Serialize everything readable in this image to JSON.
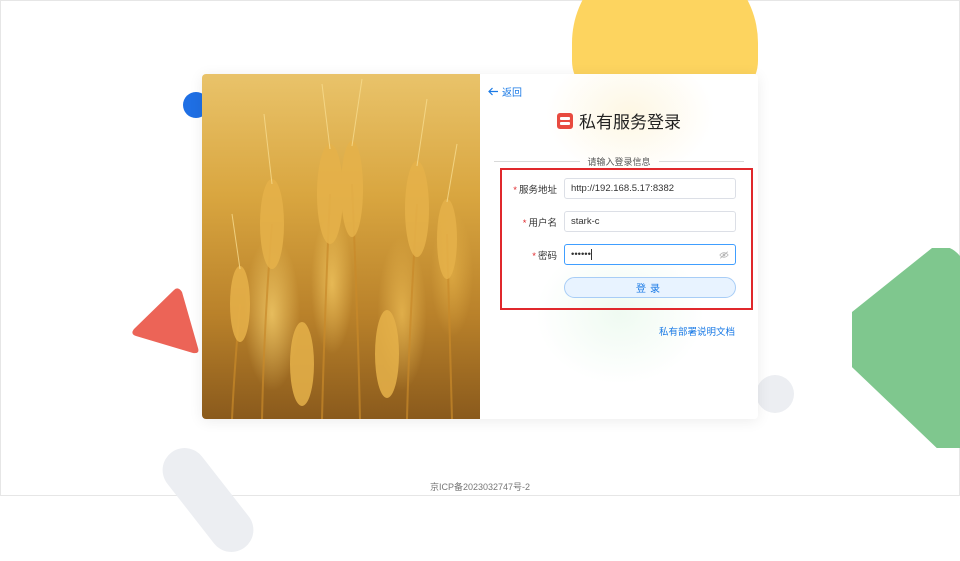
{
  "back": {
    "label": "返回"
  },
  "title": "私有服务登录",
  "divider_text": "请输入登录信息",
  "form": {
    "server": {
      "label": "服务地址",
      "value": "http://192.168.5.17:8382"
    },
    "username": {
      "label": "用户名",
      "value": "stark-c"
    },
    "password": {
      "label": "密码",
      "value": "••••••"
    },
    "required_mark": "*"
  },
  "login_button": {
    "label": "登录"
  },
  "doc_link": {
    "label": "私有部署说明文档"
  },
  "footer": {
    "icp": "京ICP备2023032747号-2"
  },
  "colors": {
    "accent": "#1a7ae6",
    "required": "#e0282c",
    "highlight_box": "#e0282c",
    "logo": "#e84a3f",
    "shape_yellow": "#fdd45f",
    "shape_red": "#ec6457",
    "shape_green": "#7fc78e",
    "shape_blue": "#1f6fe4"
  },
  "icons": [
    "arrow-left-icon",
    "server-logo-icon",
    "eye-off-icon"
  ]
}
